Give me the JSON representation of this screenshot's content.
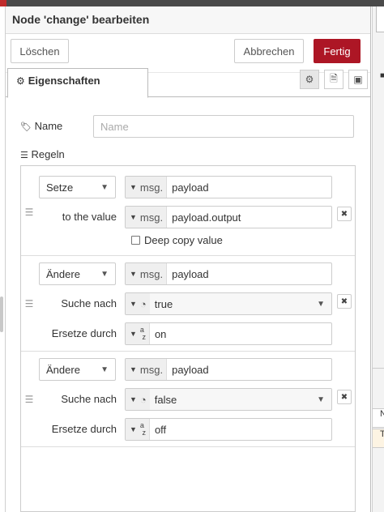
{
  "dialog": {
    "title": "Node 'change' bearbeiten",
    "buttons": {
      "delete": "Löschen",
      "cancel": "Abbrechen",
      "done": "Fertig"
    },
    "tab": "Eigenschaften"
  },
  "icons": {
    "gear": "gear-icon",
    "tag": "tag-icon",
    "list": "list-icon",
    "doc": "document-icon",
    "frame": "frame-icon",
    "drag": "drag-handle-icon",
    "close": "close-icon"
  },
  "colors": {
    "accent": "#ad1625",
    "panel_bg": "#f7f7f7"
  },
  "form": {
    "name_label": "Name",
    "name_placeholder": "Name",
    "rules_label": "Regeln"
  },
  "rules": [
    {
      "action": "Setze",
      "target_type": "msg.",
      "target": "payload",
      "second_label": "to the value",
      "value_type": "msg.",
      "value": "payload.output",
      "checkbox_label": "Deep copy value"
    },
    {
      "action": "Ändere",
      "target_type": "msg.",
      "target": "payload",
      "search_label": "Suche nach",
      "search_value": "true",
      "replace_label": "Ersetze durch",
      "replace_type_top": "a",
      "replace_type_bottom": "z",
      "replace_value": "on"
    },
    {
      "action": "Ändere",
      "target_type": "msg.",
      "target": "payload",
      "search_label": "Suche nach",
      "search_value": "false",
      "replace_label": "Ersetze durch",
      "replace_type_top": "a",
      "replace_type_bottom": "z",
      "replace_value": "off"
    }
  ],
  "right_panel": {
    "mark": "■",
    "cell1": "N",
    "cell2": "T"
  }
}
